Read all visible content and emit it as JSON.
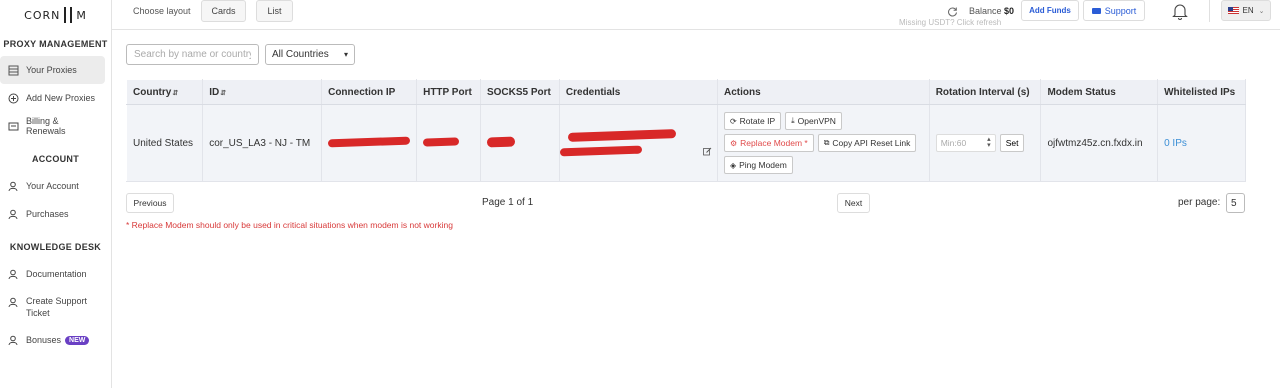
{
  "brand": {
    "name_left": "CORN",
    "name_right": "M"
  },
  "sidebar": {
    "sections": [
      {
        "title": "PROXY MANAGEMENT"
      },
      {
        "title": "ACCOUNT"
      },
      {
        "title": "KNOWLEDGE DESK"
      }
    ],
    "items": {
      "your_proxies": "Your Proxies",
      "add_new_proxies": "Add New Proxies",
      "billing_renewals": "Billing & Renewals",
      "your_account": "Your Account",
      "purchases": "Purchases",
      "documentation": "Documentation",
      "create_support_ticket": "Create Support Ticket",
      "bonuses": "Bonuses",
      "bonuses_badge": "NEW"
    }
  },
  "topbar": {
    "choose_layout": "Choose layout",
    "cards": "Cards",
    "list": "List",
    "balance_label": "Balance",
    "balance_value": "$0",
    "missing_usdt": "Missing USDT? Click refresh",
    "add_funds": "Add Funds",
    "support": "Support",
    "language": "EN"
  },
  "filters": {
    "search_placeholder": "Search by name or country",
    "country_select": "All Countries"
  },
  "table": {
    "headers": {
      "country": "Country",
      "id": "ID",
      "connection_ip": "Connection IP",
      "http_port": "HTTP Port",
      "socks5_port": "SOCKS5 Port",
      "credentials": "Credentials",
      "actions": "Actions",
      "rotation_interval": "Rotation Interval (s)",
      "modem_status": "Modem Status",
      "whitelisted_ips": "Whitelisted IPs"
    },
    "row": {
      "country": "United States",
      "id": "cor_US_LA3 - NJ - TM",
      "actions": {
        "rotate_ip": "Rotate IP",
        "openvpn": "OpenVPN",
        "replace_modem": "Replace Modem *",
        "copy_api_reset_link": "Copy API Reset Link",
        "ping_modem": "Ping Modem"
      },
      "rotation_placeholder": "Min:60",
      "set": "Set",
      "modem_status": "ojfwtmz45z.cn.fxdx.in",
      "whitelisted_ips": "0 IPs"
    }
  },
  "pagination": {
    "previous": "Previous",
    "page_info": "Page 1 of 1",
    "next": "Next",
    "per_page_label": "per page:",
    "per_page_value": "5"
  },
  "warning": "* Replace Modem should only be used in critical situations when modem is not working",
  "colors": {
    "accent_blue": "#2a5cd6",
    "danger_red": "#d83a3a",
    "status_green": "#2e8b3e",
    "badge_purple": "#6a40c4"
  }
}
